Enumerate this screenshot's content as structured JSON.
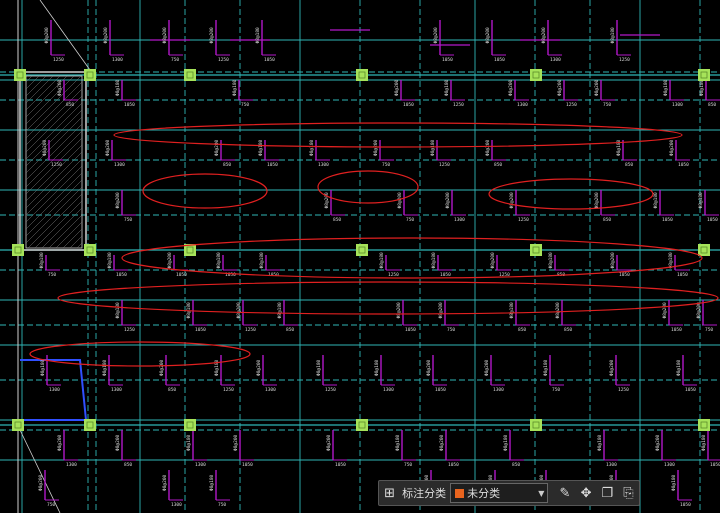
{
  "canvas": {
    "background": "#000000",
    "colors": {
      "gridline": "#2fb6b6",
      "rebar": "#b218c9",
      "cloud": "#e02020",
      "column": "#a6e35a",
      "wall_edge": "#d0d0d0",
      "text": "#d8d8d8"
    },
    "labels": {
      "rebar_spec_a": "Φ8@200",
      "rebar_spec_b": "Φ8@180",
      "length_a": "850",
      "length_b": "1250",
      "length_c": "1050",
      "length_d": "750",
      "length_e": "1300",
      "stair_note": "Φ8@200",
      "stair_note2": "Φ8@200"
    }
  },
  "toolbar": {
    "grid_icon": "four-squares-icon",
    "label": "标注分类",
    "select_value": "未分类",
    "select_color": "#e8641e",
    "actions": [
      {
        "name": "edit-icon",
        "glyph": "✎"
      },
      {
        "name": "move-icon",
        "glyph": "✥"
      },
      {
        "name": "copy-icon",
        "glyph": "❐"
      },
      {
        "name": "paste-icon",
        "glyph": "⎘"
      }
    ]
  }
}
